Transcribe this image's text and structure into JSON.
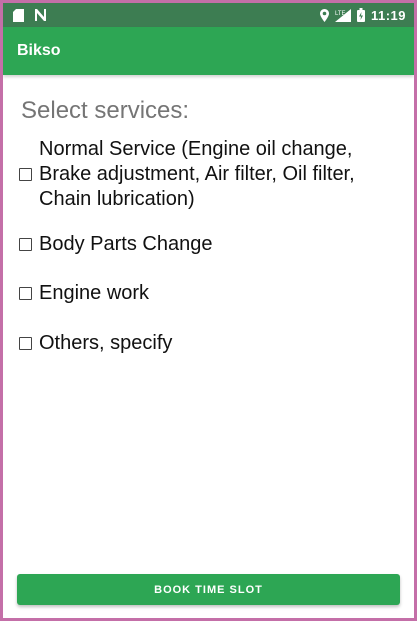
{
  "status_bar": {
    "time": "11:19",
    "network_label": "LTE",
    "icons": [
      "sd-card-icon",
      "n-notification-icon",
      "location-icon",
      "signal-icon",
      "battery-icon"
    ]
  },
  "app_bar": {
    "title": "Bikso"
  },
  "main": {
    "heading": "Select services:",
    "options": [
      {
        "label": "Normal Service (Engine oil change, Brake adjustment, Air filter, Oil filter, Chain lubrication)",
        "checked": false
      },
      {
        "label": "Body Parts Change",
        "checked": false
      },
      {
        "label": "Engine work",
        "checked": false
      },
      {
        "label": "Others, specify",
        "checked": false
      }
    ]
  },
  "footer": {
    "button_label": "BOOK TIME SLOT"
  },
  "colors": {
    "status_bar": "#3d7d52",
    "app_bar": "#2da654",
    "button": "#2da654",
    "heading_text": "#757575"
  }
}
